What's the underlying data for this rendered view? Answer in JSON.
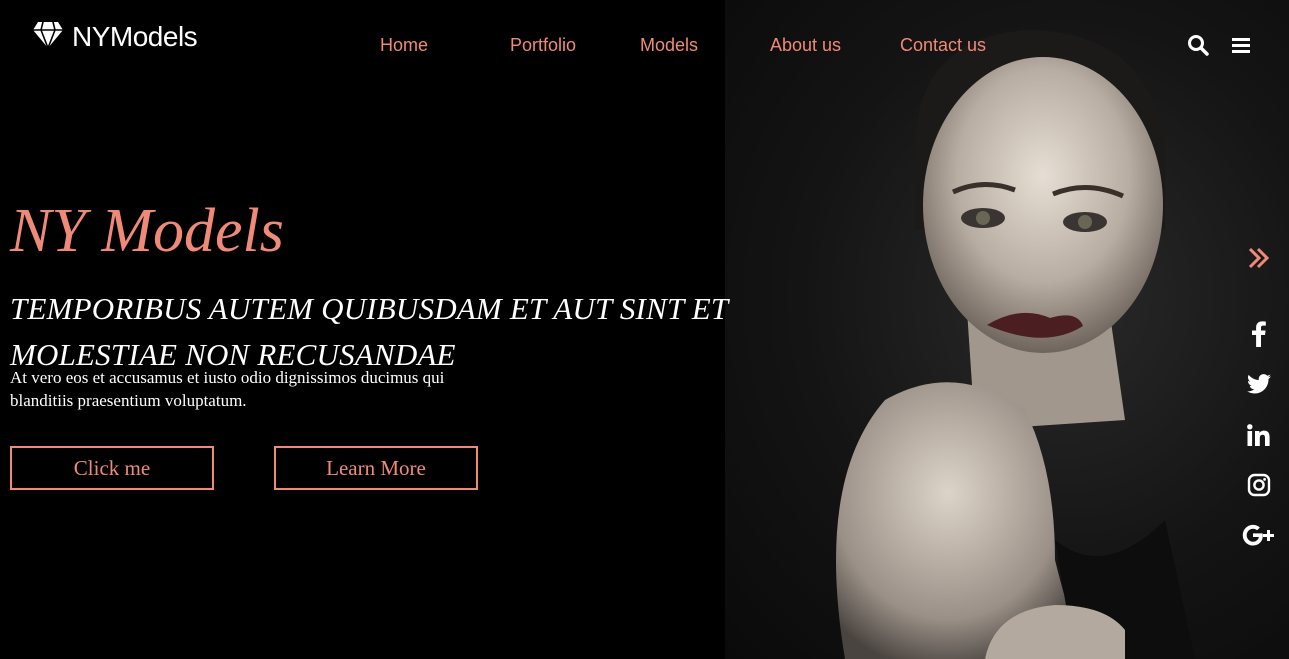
{
  "brand": {
    "name": "NYModels",
    "logo_icon": "diamond-icon"
  },
  "nav": {
    "items": [
      "Home",
      "Portfolio",
      "Models",
      "About us",
      "Contact us"
    ],
    "search_icon": "search-icon",
    "menu_icon": "hamburger-menu-icon"
  },
  "hero": {
    "title": "NY Models",
    "subtitle": "Temporibus autem quibusdam et aut sint et molestiae non recusandae",
    "description": "At vero eos et accusamus et iusto odio dignissimos ducimus qui blanditiis praesentium voluptatum.",
    "buttons": [
      "Click me",
      "Learn More"
    ]
  },
  "sidebar": {
    "expand_icon": "double-chevron-right-icon",
    "social": [
      "facebook-icon",
      "twitter-icon",
      "linkedin-icon",
      "instagram-icon",
      "google-plus-icon"
    ]
  },
  "colors": {
    "accent": "#f08a78",
    "background": "#000000",
    "text": "#ffffff"
  }
}
